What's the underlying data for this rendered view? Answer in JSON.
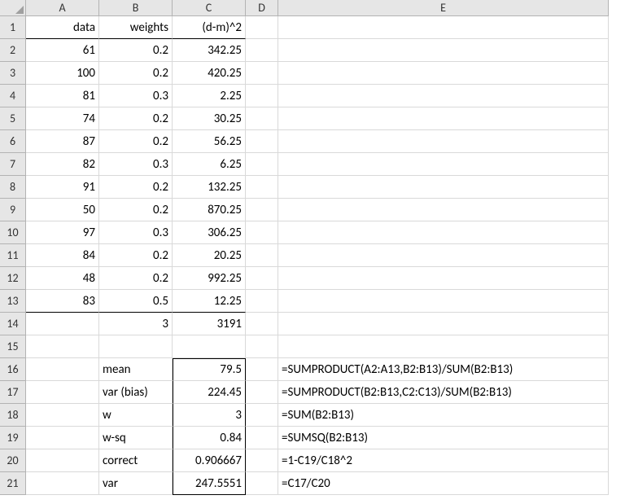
{
  "colHeaders": [
    "A",
    "B",
    "C",
    "D",
    "E"
  ],
  "rowHeaders": [
    "1",
    "2",
    "3",
    "4",
    "5",
    "6",
    "7",
    "8",
    "9",
    "10",
    "11",
    "12",
    "13",
    "14",
    "15",
    "16",
    "17",
    "18",
    "19",
    "20",
    "21"
  ],
  "grid": {
    "r1": {
      "A": "data",
      "B": "weights",
      "C": "(d-m)^2"
    },
    "r2": {
      "A": "61",
      "B": "0.2",
      "C": "342.25"
    },
    "r3": {
      "A": "100",
      "B": "0.2",
      "C": "420.25"
    },
    "r4": {
      "A": "81",
      "B": "0.3",
      "C": "2.25"
    },
    "r5": {
      "A": "74",
      "B": "0.2",
      "C": "30.25"
    },
    "r6": {
      "A": "87",
      "B": "0.2",
      "C": "56.25"
    },
    "r7": {
      "A": "82",
      "B": "0.3",
      "C": "6.25"
    },
    "r8": {
      "A": "91",
      "B": "0.2",
      "C": "132.25"
    },
    "r9": {
      "A": "50",
      "B": "0.2",
      "C": "870.25"
    },
    "r10": {
      "A": "97",
      "B": "0.3",
      "C": "306.25"
    },
    "r11": {
      "A": "84",
      "B": "0.2",
      "C": "20.25"
    },
    "r12": {
      "A": "48",
      "B": "0.2",
      "C": "992.25"
    },
    "r13": {
      "A": "83",
      "B": "0.5",
      "C": "12.25"
    },
    "r14": {
      "B": "3",
      "C": "3191"
    },
    "r16": {
      "B": "mean",
      "C": "79.5",
      "E": "=SUMPRODUCT(A2:A13,B2:B13)/SUM(B2:B13)"
    },
    "r17": {
      "B": "var (bias)",
      "C": "224.45",
      "E": "=SUMPRODUCT(B2:B13,C2:C13)/SUM(B2:B13)"
    },
    "r18": {
      "B": "w",
      "C": "3",
      "E": "=SUM(B2:B13)"
    },
    "r19": {
      "B": "w-sq",
      "C": "0.84",
      "E": "=SUMSQ(B2:B13)"
    },
    "r20": {
      "B": "correct",
      "C": "0.906667",
      "E": "=1-C19/C18^2"
    },
    "r21": {
      "B": "var",
      "C": "247.5551",
      "E": "=C17/C20"
    }
  },
  "chart_data": {
    "type": "table",
    "title": "Weighted variance computation",
    "columns": [
      "data",
      "weights",
      "(d-m)^2"
    ],
    "rows": [
      [
        61,
        0.2,
        342.25
      ],
      [
        100,
        0.2,
        420.25
      ],
      [
        81,
        0.3,
        2.25
      ],
      [
        74,
        0.2,
        30.25
      ],
      [
        87,
        0.2,
        56.25
      ],
      [
        82,
        0.3,
        6.25
      ],
      [
        91,
        0.2,
        132.25
      ],
      [
        50,
        0.2,
        870.25
      ],
      [
        97,
        0.3,
        306.25
      ],
      [
        84,
        0.2,
        20.25
      ],
      [
        48,
        0.2,
        992.25
      ],
      [
        83,
        0.5,
        12.25
      ]
    ],
    "sums": {
      "weights": 3,
      "(d-m)^2": 3191
    },
    "stats": {
      "mean": 79.5,
      "var_bias": 224.45,
      "w": 3,
      "w_sq": 0.84,
      "correct": 0.906667,
      "var": 247.5551
    },
    "formulas": {
      "mean": "=SUMPRODUCT(A2:A13,B2:B13)/SUM(B2:B13)",
      "var_bias": "=SUMPRODUCT(B2:B13,C2:C13)/SUM(B2:B13)",
      "w": "=SUM(B2:B13)",
      "w_sq": "=SUMSQ(B2:B13)",
      "correct": "=1-C19/C18^2",
      "var": "=C17/C20"
    }
  }
}
